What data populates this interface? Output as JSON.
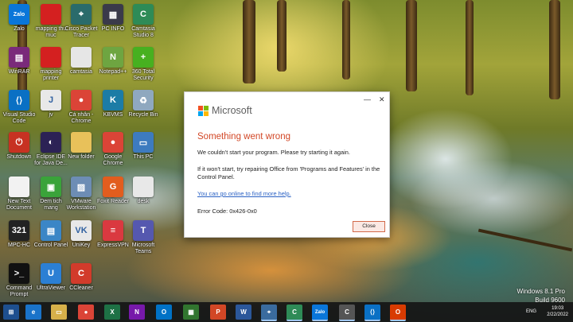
{
  "desktop_icons": [
    {
      "label": "Zalo",
      "icon": "zalo-icon",
      "color": "#0a76d9",
      "glyph": "Zalo"
    },
    {
      "label": "mapping thu muc",
      "icon": "folder-red-icon",
      "color": "#d42020",
      "glyph": ""
    },
    {
      "label": "Cisco Packet Tracer",
      "icon": "cisco-icon",
      "color": "#2a6b6b",
      "glyph": "⌖"
    },
    {
      "label": "PC INFO",
      "icon": "pcinfo-icon",
      "color": "#3a3a4a",
      "glyph": "▦"
    },
    {
      "label": "Camtasia Studio 8",
      "icon": "camtasia-icon",
      "color": "#2e8b57",
      "glyph": "C"
    },
    {
      "label": "WinRAR",
      "icon": "winrar-icon",
      "color": "#7a2a7a",
      "glyph": "▤"
    },
    {
      "label": "mapping printer",
      "icon": "folder-red-icon",
      "color": "#d42020",
      "glyph": ""
    },
    {
      "label": "camtasia",
      "icon": "document-icon",
      "color": "#e6e6e6",
      "glyph": ""
    },
    {
      "label": "Notepad++",
      "icon": "notepadpp-icon",
      "color": "#6ea541",
      "glyph": "N"
    },
    {
      "label": "360 Total Security",
      "icon": "security-plus-icon",
      "color": "#47b020",
      "glyph": "+"
    },
    {
      "label": "Visual Studio Code",
      "icon": "vscode-icon",
      "color": "#0a70c4",
      "glyph": "⟨⟩"
    },
    {
      "label": "jv",
      "icon": "java-file-icon",
      "color": "#e8e8e8",
      "glyph": "J"
    },
    {
      "label": "Cá nhân - Chrome",
      "icon": "chrome-icon",
      "color": "#db4437",
      "glyph": "●"
    },
    {
      "label": "KBVMS",
      "icon": "kbvms-icon",
      "color": "#1c7ca6",
      "glyph": "K"
    },
    {
      "label": "Recycle Bin",
      "icon": "recycle-bin-icon",
      "color": "#8fa8bf",
      "glyph": "♻"
    },
    {
      "label": "Shutdown",
      "icon": "power-icon",
      "color": "#c73222",
      "glyph": "⏻"
    },
    {
      "label": "Eclipse IDE for Java De...",
      "icon": "eclipse-icon",
      "color": "#2c2255",
      "glyph": "◐"
    },
    {
      "label": "New folder",
      "icon": "folder-icon",
      "color": "#e8c15a",
      "glyph": ""
    },
    {
      "label": "Google Chrome",
      "icon": "chrome-icon",
      "color": "#db4437",
      "glyph": "●"
    },
    {
      "label": "This PC",
      "icon": "computer-icon",
      "color": "#3d7bbf",
      "glyph": "▭"
    },
    {
      "label": "New Text Document",
      "icon": "text-document-icon",
      "color": "#f2f2f2",
      "glyph": ""
    },
    {
      "label": "Dem tich mang",
      "icon": "network-icon",
      "color": "#3aa33a",
      "glyph": "▣"
    },
    {
      "label": "VMware Workstation",
      "icon": "vmware-icon",
      "color": "#6d8db5",
      "glyph": "▨"
    },
    {
      "label": "Foxit Reader",
      "icon": "foxit-icon",
      "color": "#e25d1e",
      "glyph": "G"
    },
    {
      "label": "desk",
      "icon": "file-icon",
      "color": "#e8e8e8",
      "glyph": ""
    },
    {
      "label": "MPC-HC",
      "icon": "mpchc-icon",
      "color": "#222222",
      "glyph": "321"
    },
    {
      "label": "Control Panel",
      "icon": "control-panel-icon",
      "color": "#3b86c6",
      "glyph": "▤"
    },
    {
      "label": "UniKey",
      "icon": "unikey-icon",
      "color": "#e8e8e8",
      "glyph": "VK"
    },
    {
      "label": "ExpressVPN",
      "icon": "expressvpn-icon",
      "color": "#da3940",
      "glyph": "≡"
    },
    {
      "label": "Microsoft Teams",
      "icon": "teams-icon",
      "color": "#5558af",
      "glyph": "T"
    },
    {
      "label": "Command Prompt",
      "icon": "cmd-icon",
      "color": "#111111",
      "glyph": "&gt;_"
    },
    {
      "label": "UltraViewer",
      "icon": "ultraviewer-icon",
      "color": "#2b7fd4",
      "glyph": "U"
    },
    {
      "label": "CCleaner",
      "icon": "ccleaner-icon",
      "color": "#d23b2b",
      "glyph": "C"
    }
  ],
  "dialog": {
    "brand": "Microsoft",
    "minimize": "—",
    "close_x": "✕",
    "title": "Something went wrong",
    "line1": "We couldn't start your program. Please try starting it again.",
    "line2": "If it won't start, try repairing Office from 'Programs and Features' in the Control Panel.",
    "link": "You can go online to find more help.",
    "error_code": "Error Code: 0x426-0x0",
    "close_label": "Close"
  },
  "os_info": {
    "edition": "Windows 8.1 Pro",
    "build": "Build 9600"
  },
  "taskbar": {
    "items": [
      {
        "name": "start-icon",
        "glyph": "⊞",
        "color": "#1e4f8f"
      },
      {
        "name": "internet-explorer-icon",
        "glyph": "e",
        "color": "#1a73c9"
      },
      {
        "name": "file-explorer-icon",
        "glyph": "▭",
        "color": "#d6b04a"
      },
      {
        "name": "chrome-icon",
        "glyph": "●",
        "color": "#db4437"
      },
      {
        "name": "excel-icon",
        "glyph": "X",
        "color": "#1e7145"
      },
      {
        "name": "onenote-icon",
        "glyph": "N",
        "color": "#7719aa"
      },
      {
        "name": "outlook-icon",
        "glyph": "O",
        "color": "#0072c6"
      },
      {
        "name": "project-icon",
        "glyph": "▦",
        "color": "#31752f"
      },
      {
        "name": "powerpoint-icon",
        "glyph": "P",
        "color": "#d24726"
      },
      {
        "name": "word-icon",
        "glyph": "W",
        "color": "#2b579a"
      },
      {
        "name": "packet-tracer-icon",
        "glyph": "⌖",
        "color": "#3a6b9e"
      },
      {
        "name": "camtasia-icon",
        "glyph": "C",
        "color": "#2e8b57"
      },
      {
        "name": "zalo-icon",
        "glyph": "Zalo",
        "color": "#0a76d9"
      },
      {
        "name": "camtasia-recorder-icon",
        "glyph": "C",
        "color": "#555555"
      },
      {
        "name": "vscode-icon",
        "glyph": "⟨⟩",
        "color": "#0a70c4"
      },
      {
        "name": "office-icon",
        "glyph": "O",
        "color": "#d83b01"
      }
    ],
    "tray": {
      "language": "ENG",
      "time": "19:03",
      "date": "2/22/2022"
    }
  }
}
